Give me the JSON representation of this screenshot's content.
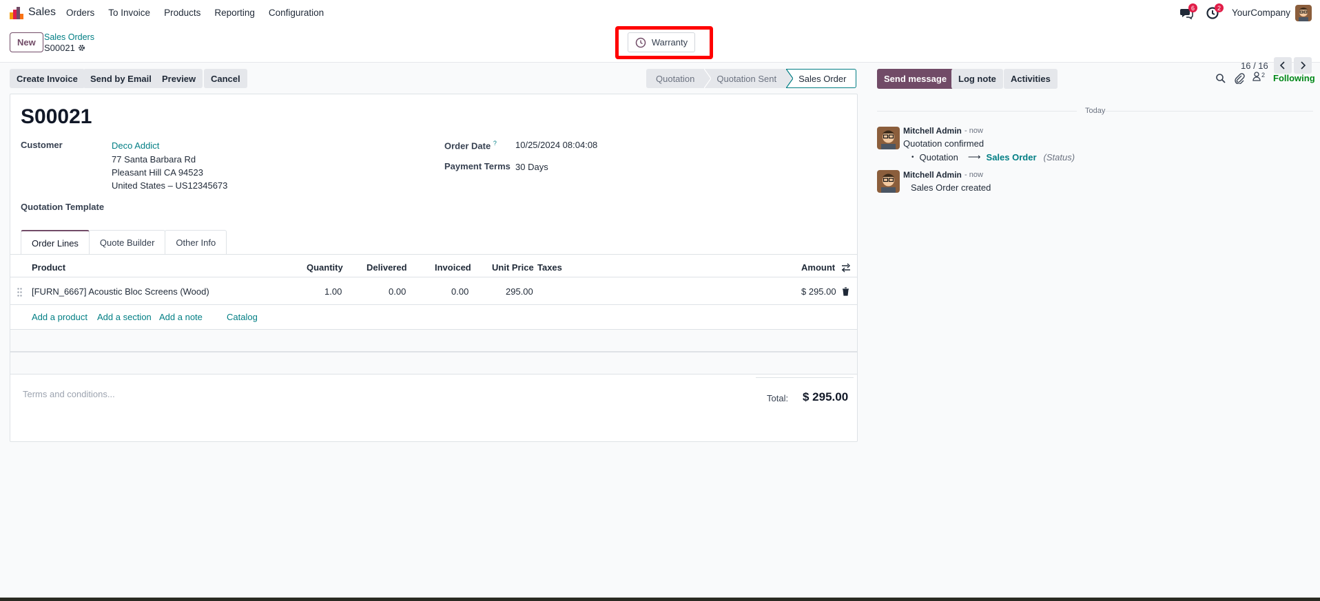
{
  "topbar": {
    "app_name": "Sales",
    "menu": [
      "Orders",
      "To Invoice",
      "Products",
      "Reporting",
      "Configuration"
    ],
    "messages_badge": "6",
    "activities_badge": "2",
    "company": "YourCompany"
  },
  "control": {
    "new_label": "New",
    "breadcrumb_parent": "Sales Orders",
    "breadcrumb_current": "S00021",
    "smart_button_label": "Warranty",
    "pager": "16 / 16"
  },
  "actions": {
    "create_invoice": "Create Invoice",
    "send_email": "Send by Email",
    "preview": "Preview",
    "cancel": "Cancel"
  },
  "statusbar": {
    "steps": [
      "Quotation",
      "Quotation Sent",
      "Sales Order"
    ],
    "active": "Sales Order"
  },
  "form": {
    "title": "S00021",
    "customer_label": "Customer",
    "customer_name": "Deco Addict",
    "address_line1": "77 Santa Barbara Rd",
    "address_line2": "Pleasant Hill CA 94523",
    "address_line3": "United States – US12345673",
    "order_date_label": "Order Date",
    "order_date_help": "?",
    "order_date_value": "10/25/2024 08:04:08",
    "payment_terms_label": "Payment Terms",
    "payment_terms_value": "30 Days",
    "quotation_template_label": "Quotation Template",
    "tabs": [
      "Order Lines",
      "Quote Builder",
      "Other Info"
    ],
    "columns": {
      "product": "Product",
      "quantity": "Quantity",
      "delivered": "Delivered",
      "invoiced": "Invoiced",
      "unit_price": "Unit Price",
      "taxes": "Taxes",
      "amount": "Amount"
    },
    "lines": [
      {
        "product": "[FURN_6667] Acoustic Bloc Screens (Wood)",
        "quantity": "1.00",
        "delivered": "0.00",
        "invoiced": "0.00",
        "unit_price": "295.00",
        "taxes": "",
        "amount": "$ 295.00"
      }
    ],
    "add_product": "Add a product",
    "add_section": "Add a section",
    "add_note": "Add a note",
    "catalog": "Catalog",
    "terms_placeholder": "Terms and conditions...",
    "total_label": "Total:",
    "total_value": "$ 295.00"
  },
  "chatter": {
    "send_message": "Send message",
    "log_note": "Log note",
    "activities": "Activities",
    "followers_count": "2",
    "following": "Following",
    "date_separator": "Today",
    "messages": [
      {
        "author": "Mitchell Admin",
        "when": "- now",
        "text": "Quotation confirmed",
        "change_old": "Quotation",
        "change_new": "Sales Order",
        "change_field": "(Status)"
      },
      {
        "author": "Mitchell Admin",
        "when": "- now",
        "text": "Sales Order created"
      }
    ]
  },
  "colors": {
    "brand": "#714b67",
    "link": "#017e84",
    "following": "#008818",
    "badge": "#e11d48",
    "highlight": "#ff0000"
  }
}
